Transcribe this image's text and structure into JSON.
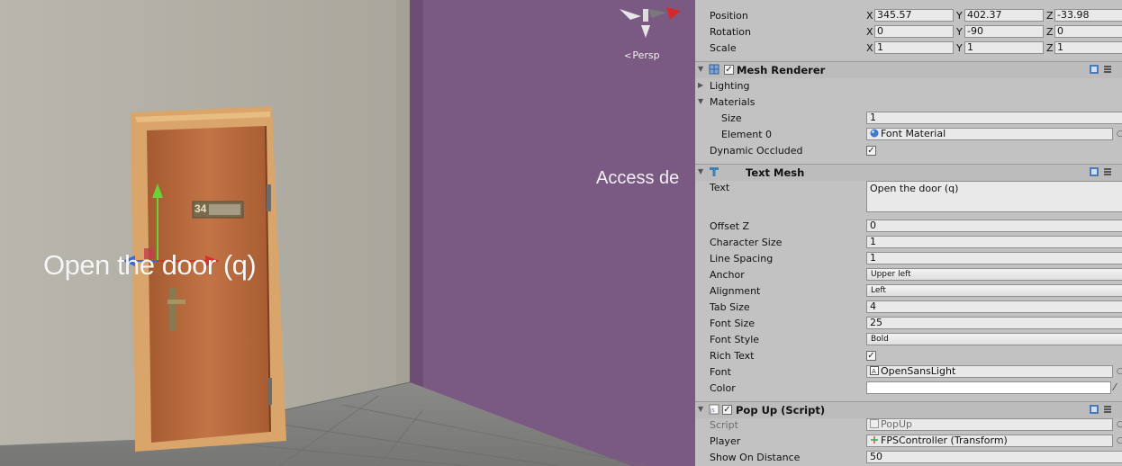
{
  "scene": {
    "persp_label": "Persp",
    "access_text": "Access de",
    "floating_text": "Open the door (q)",
    "door_plate_number": "34"
  },
  "inspector": {
    "transform": {
      "position": {
        "label": "Position",
        "x": "345.57",
        "y": "402.37",
        "z": "-33.98"
      },
      "rotation": {
        "label": "Rotation",
        "x": "0",
        "y": "-90",
        "z": "0"
      },
      "scale": {
        "label": "Scale",
        "x": "1",
        "y": "1",
        "z": "1"
      },
      "axis_x": "X",
      "axis_y": "Y",
      "axis_z": "Z"
    },
    "mesh_renderer": {
      "title": "Mesh Renderer",
      "lighting": "Lighting",
      "materials": "Materials",
      "size_label": "Size",
      "size_value": "1",
      "element0_label": "Element 0",
      "element0_value": "Font Material",
      "dynamic_occluded": "Dynamic Occluded",
      "dynamic_occluded_checked": true
    },
    "text_mesh": {
      "title": "Text Mesh",
      "text_label": "Text",
      "text_value": "Open the door (q)",
      "offset_z_label": "Offset Z",
      "offset_z": "0",
      "char_size_label": "Character Size",
      "char_size": "1",
      "line_spacing_label": "Line Spacing",
      "line_spacing": "1",
      "anchor_label": "Anchor",
      "anchor": "Upper left",
      "alignment_label": "Alignment",
      "alignment": "Left",
      "tab_size_label": "Tab Size",
      "tab_size": "4",
      "font_size_label": "Font Size",
      "font_size": "25",
      "font_style_label": "Font Style",
      "font_style": "Bold",
      "rich_text_label": "Rich Text",
      "rich_text_checked": true,
      "font_label": "Font",
      "font": "OpenSansLight",
      "color_label": "Color",
      "color_value": "#ffffff"
    },
    "popup_script": {
      "title": "Pop Up (Script)",
      "script_label": "Script",
      "script_value": "PopUp",
      "player_label": "Player",
      "player_value": "FPSController (Transform)",
      "show_on_distance_label": "Show On Distance",
      "show_on_distance": "50"
    }
  },
  "colors": {
    "purple_wall": "#7a5a82",
    "door_wood": "#b8683a",
    "inspector_bg": "#c2c2c2"
  }
}
